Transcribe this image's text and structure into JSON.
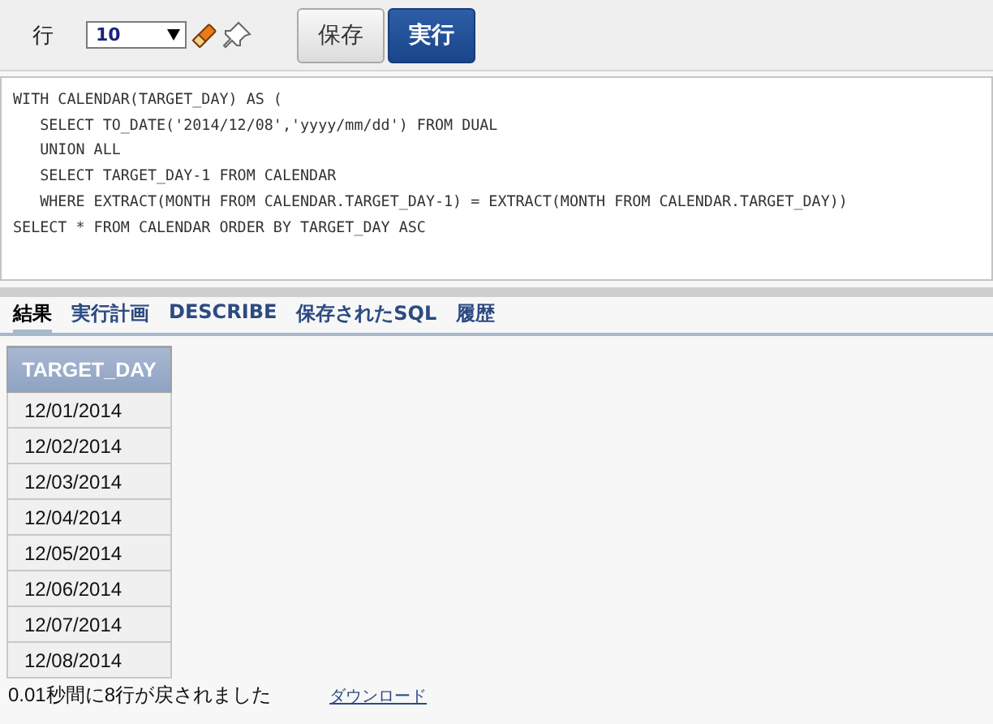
{
  "toolbar": {
    "rows_label": "行",
    "rows_select": {
      "value": "10"
    },
    "buttons": [
      {
        "label": "保存",
        "kind": "secondary"
      },
      {
        "label": "実行",
        "kind": "primary"
      }
    ]
  },
  "editor": {
    "lines": [
      "WITH CALENDAR(TARGET_DAY) AS (",
      "   SELECT TO_DATE('2014/12/08','yyyy/mm/dd') FROM DUAL",
      "   UNION ALL",
      "   SELECT TARGET_DAY-1 FROM CALENDAR",
      "   WHERE EXTRACT(MONTH FROM CALENDAR.TARGET_DAY-1) = EXTRACT(MONTH FROM CALENDAR.TARGET_DAY))",
      "SELECT * FROM CALENDAR ORDER BY TARGET_DAY ASC"
    ]
  },
  "tabs": [
    {
      "label": "結果",
      "selected": true
    },
    {
      "label": "実行計画",
      "selected": false
    },
    {
      "label": "DESCRIBE",
      "selected": false
    },
    {
      "label": "保存されたSQL",
      "selected": false
    },
    {
      "label": "履歴",
      "selected": false
    }
  ],
  "table": {
    "columns": [
      "TARGET_DAY"
    ],
    "rows": [
      [
        "12/01/2014"
      ],
      [
        "12/02/2014"
      ],
      [
        "12/03/2014"
      ],
      [
        "12/04/2014"
      ],
      [
        "12/05/2014"
      ],
      [
        "12/06/2014"
      ],
      [
        "12/07/2014"
      ],
      [
        "12/08/2014"
      ]
    ]
  },
  "footer": {
    "message": "0.01秒間に8行が戻されました",
    "link": "ダウンロード"
  }
}
